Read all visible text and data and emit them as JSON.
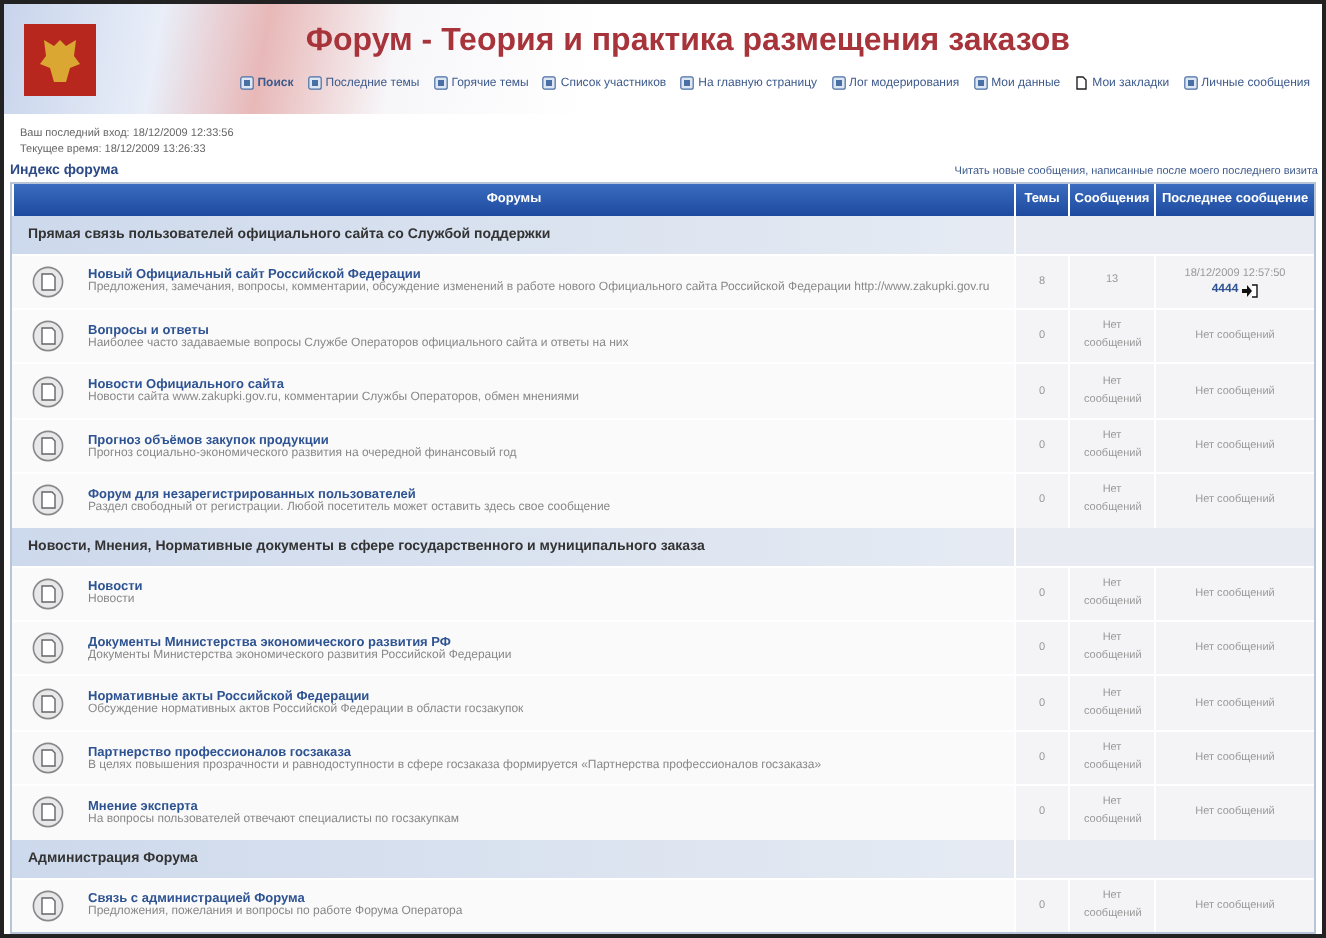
{
  "header": {
    "title": "Форум - Теория и практика размещения заказов",
    "nav": [
      {
        "label": "Поиск",
        "bold": true
      },
      {
        "label": "Последние темы",
        "bold": false
      },
      {
        "label": "Горячие темы",
        "bold": false
      },
      {
        "label": "Список участников",
        "bold": false
      },
      {
        "label": "На главную страницу",
        "bold": false
      },
      {
        "label": "Лог модерирования",
        "bold": false
      },
      {
        "label": "Мои данные",
        "bold": false
      },
      {
        "label": "Мои закладки",
        "bold": false
      },
      {
        "label": "Личные сообщения",
        "bold": false
      }
    ]
  },
  "info": {
    "last_visit": "Ваш последний вход: 18/12/2009 12:33:56",
    "current_time": "Текущее время: 18/12/2009 13:26:33",
    "breadcrumb": "Индекс форума",
    "unread_link": "Читать новые сообщения, написанные после моего последнего визита"
  },
  "table": {
    "columns": [
      "Форумы",
      "Темы",
      "Сообщения",
      "Последнее сообщение"
    ],
    "categories": [
      {
        "title": "Прямая связь пользователей официального сайта со Службой поддержки",
        "forums": [
          {
            "name": "Новый Официальный сайт Российской Федерации",
            "description": "Предложения, замечания, вопросы, комментарии, обсуждение изменений в работе нового Официального сайта Российской Федерации http://www.zakupki.gov.ru",
            "topics": "8",
            "posts": "13",
            "last_post": {
              "kind": "post",
              "date": "18/12/2009 12:57:50",
              "author": "4444"
            }
          },
          {
            "name": "Вопросы и ответы",
            "description": "Наиболее часто задаваемые вопросы Службе Операторов официального сайта и ответы на них",
            "topics": "0",
            "posts": "Нет сообщений",
            "last_post": {
              "kind": "none",
              "text": "Нет сообщений"
            }
          },
          {
            "name": "Новости Официального сайта",
            "description": "Новости сайта www.zakupki.gov.ru, комментарии Службы Операторов, обмен мнениями",
            "topics": "0",
            "posts": "Нет сообщений",
            "last_post": {
              "kind": "none",
              "text": "Нет сообщений"
            }
          },
          {
            "name": "Прогноз объёмов закупок продукции",
            "description": "Прогноз социально-экономического развития на очередной финансовый год",
            "topics": "0",
            "posts": "Нет сообщений",
            "last_post": {
              "kind": "none",
              "text": "Нет сообщений"
            }
          },
          {
            "name": "Форум для незарегистрированных пользователей",
            "description": "Раздел свободный от регистрации. Любой посетитель может оставить здесь свое сообщение",
            "topics": "0",
            "posts": "Нет сообщений",
            "last_post": {
              "kind": "none",
              "text": "Нет сообщений"
            }
          }
        ]
      },
      {
        "title": "Новости, Мнения, Нормативные документы в сфере государственного и муниципального заказа",
        "forums": [
          {
            "name": "Новости",
            "description": "Новости",
            "topics": "0",
            "posts": "Нет сообщений",
            "last_post": {
              "kind": "none",
              "text": "Нет сообщений"
            }
          },
          {
            "name": "Документы Министерства экономического развития РФ",
            "description": "Документы Министерства экономического развития Российской Федерации",
            "topics": "0",
            "posts": "Нет сообщений",
            "last_post": {
              "kind": "none",
              "text": "Нет сообщений"
            }
          },
          {
            "name": "Нормативные акты Российской Федерации",
            "description": "Обсуждение нормативных актов Российской Федерации в области госзакупок",
            "topics": "0",
            "posts": "Нет сообщений",
            "last_post": {
              "kind": "none",
              "text": "Нет сообщений"
            }
          },
          {
            "name": "Партнерство профессионалов госзаказа",
            "description": "В целях повышения прозрачности и равнодоступности в сфере госзаказа формируется «Партнерства профессионалов госзаказа»",
            "topics": "0",
            "posts": "Нет сообщений",
            "last_post": {
              "kind": "none",
              "text": "Нет сообщений"
            }
          },
          {
            "name": "Мнение эксперта",
            "description": "На вопросы пользователей отвечают специалисты по госзакупкам",
            "topics": "0",
            "posts": "Нет сообщений",
            "last_post": {
              "kind": "none",
              "text": "Нет сообщений"
            }
          }
        ]
      },
      {
        "title": "Администрация Форума",
        "forums": [
          {
            "name": "Связь с администрацией Форума",
            "description": "Предложения, пожелания и вопросы по работе Форума Оператора",
            "topics": "0",
            "posts": "Нет сообщений",
            "last_post": {
              "kind": "none",
              "text": "Нет сообщений"
            }
          }
        ]
      }
    ]
  }
}
